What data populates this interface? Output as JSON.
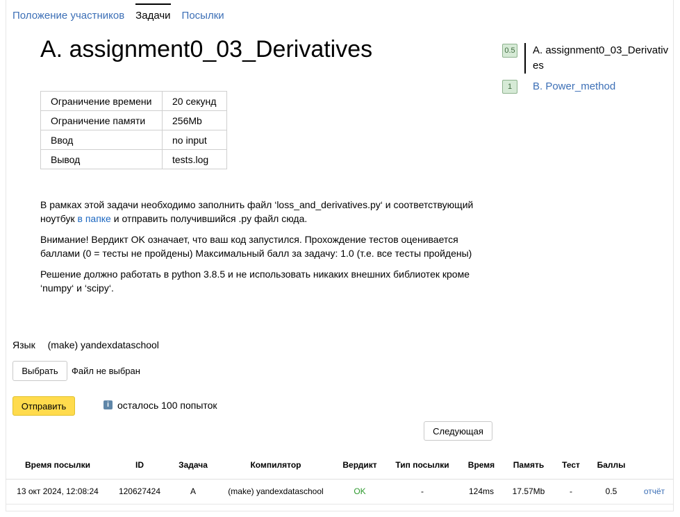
{
  "nav": {
    "tabs": [
      {
        "label": "Положение участников"
      },
      {
        "label": "Задачи"
      },
      {
        "label": "Посылки"
      }
    ]
  },
  "problem": {
    "title": "A. assignment0_03_Derivatives",
    "limits": [
      {
        "key": "Ограничение времени",
        "value": "20 секунд"
      },
      {
        "key": "Ограничение памяти",
        "value": "256Mb"
      },
      {
        "key": "Ввод",
        "value": "no input"
      },
      {
        "key": "Вывод",
        "value": "tests.log"
      }
    ],
    "p1_a": "В рамках этой задачи необходимо заполнить файл ‘loss_and_derivatives.py‘ и соответствующий ноутбук ",
    "p1_link": "в папке",
    "p1_b": " и отправить получившийся .py файл сюда.",
    "p2": "Внимание! Вердикт OK означает, что ваш код запустился. Прохождение тестов оценивается баллами (0 = тесты не пройдены) Максимальный балл за задачу: 1.0 (т.е. все тесты пройдены)",
    "p3": "Решение должно работать в python 3.8.5 и не использовать никаких внешних библиотек кроме ‘numpy‘ и ‘scipy‘."
  },
  "sidebar": {
    "items": [
      {
        "score": "0.5",
        "label": "A. assignment0_03_Derivatives"
      },
      {
        "score": "1",
        "label": "B. Power_method"
      }
    ]
  },
  "submit_form": {
    "lang_label": "Язык",
    "lang_value": "(make) yandexdataschool",
    "choose_label": "Выбрать",
    "no_file": "Файл не выбран",
    "submit_label": "Отправить",
    "info_icon": "i",
    "attempts": "осталось 100 попыток",
    "next_label": "Следующая"
  },
  "submissions": {
    "headers": [
      "Время посылки",
      "ID",
      "Задача",
      "Компилятор",
      "Вердикт",
      "Тип посылки",
      "Время",
      "Память",
      "Тест",
      "Баллы",
      ""
    ],
    "rows": [
      {
        "time": "13 окт 2024, 12:08:24",
        "id": "120627424",
        "task": "A",
        "compiler": "(make) yandexdataschool",
        "verdict": "OK",
        "type": "-",
        "run_time": "124ms",
        "memory": "17.57Mb",
        "test": "-",
        "score": "0.5",
        "report": "отчёт"
      }
    ]
  },
  "colors": {
    "link": "#3c6fb6",
    "ok": "#2e9a2e",
    "submit_button": "#ffdb4d",
    "badge_bg": "#d6ead6"
  }
}
